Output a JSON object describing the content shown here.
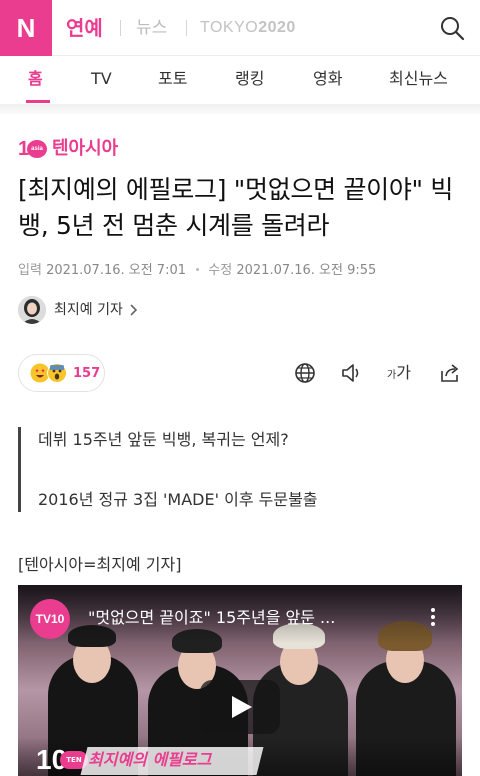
{
  "header": {
    "logo": "N",
    "section": "연예",
    "news_link": "뉴스",
    "tokyo_prefix": "TOKYO",
    "tokyo_year": "2020",
    "search_icon": "search-icon"
  },
  "nav": {
    "items": [
      "홈",
      "TV",
      "포토",
      "랭킹",
      "영화",
      "최신뉴스"
    ],
    "active_index": 0
  },
  "colors": {
    "accent": "#ea3d8f",
    "text": "#222222",
    "muted": "#888888"
  },
  "article": {
    "source_one": "1",
    "source_circle": "asia",
    "source_name": "텐아시아",
    "headline": "[최지예의 에필로그] \"멋없으면 끝이야\" 빅뱅, 5년 전 멈춘 시계를 돌려라",
    "dates": {
      "input_label": "입력",
      "input_value": "2021.07.16. 오전 7:01",
      "modified_label": "수정",
      "modified_value": "2021.07.16. 오전 9:55"
    },
    "reporter": "최지예 기자",
    "reactions": {
      "count": "157",
      "emojis": [
        "heart-eyes-emoji",
        "surprised-emoji"
      ]
    },
    "tools": [
      "globe-icon",
      "speaker-icon",
      "font-size-icon",
      "share-icon"
    ],
    "font_tool_small": "가",
    "font_tool_large": "가",
    "summary": [
      "데뷔 15주년 앞둔 빅뱅, 복귀는 언제?",
      "2016년 정규 3집 'MADE' 이후 두문불출"
    ],
    "byline": "[텐아시아=최지예 기자]"
  },
  "video": {
    "channel_badge": "TV10",
    "title": "\"멋없으면 끝이죠\" 15주년을 앞둔 ...",
    "ten_number": "10",
    "ten_label": "TEN",
    "caption": "최지예의 에필로그"
  }
}
